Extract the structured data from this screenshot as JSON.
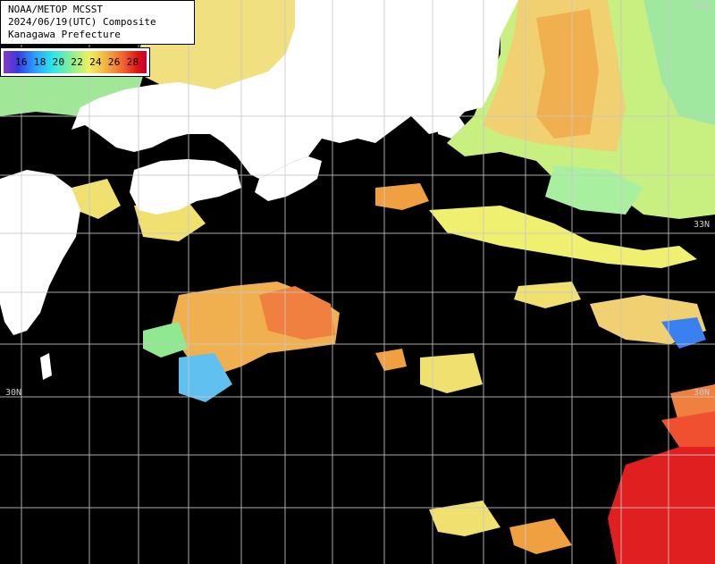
{
  "title": {
    "line1": "NOAA/METOP MCSST",
    "line2": "2024/06/19(UTC) Composite",
    "line3": "Kanagawa Prefecture"
  },
  "legend": {
    "labels": "16 18 20 22 24 26 28"
  },
  "lat_labels": {
    "left_30": "30N",
    "right_30": "30N",
    "right_33": "33N",
    "top_right": "35N"
  },
  "colors": {
    "land": "#ffffff",
    "no_data": "#000000",
    "grid": "#c8c8c8",
    "cold": "#3a3ae0",
    "mid": "#90f090",
    "warm": "#f0a040",
    "hot": "#e01010"
  }
}
